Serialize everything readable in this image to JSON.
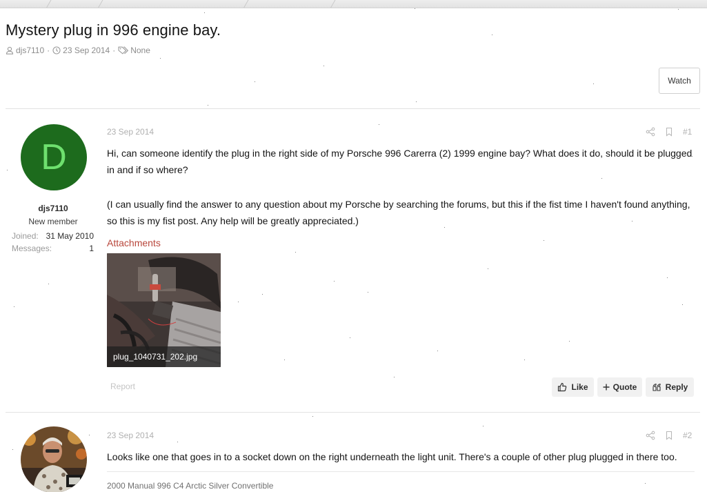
{
  "thread": {
    "title": "Mystery plug in 996 engine bay.",
    "author": "djs7110",
    "date": "23 Sep 2014",
    "tags": "None",
    "watch_label": "Watch"
  },
  "posts": [
    {
      "number": "#1",
      "date": "23 Sep 2014",
      "user": {
        "avatar_letter": "D",
        "avatar_color": "#1d6b1d",
        "name": "djs7110",
        "title": "New member",
        "joined_label": "Joined:",
        "joined_value": "31 May 2010",
        "messages_label": "Messages:",
        "messages_value": "1"
      },
      "paragraphs": [
        "Hi, can someone identify the plug in the right side of my Porsche 996 Carerra (2) 1999 engine bay? What does it do, should it be plugged in and if so where?",
        "(I can usually find the answer to any question about my Porsche by searching the forums, but this if the fist time I haven't found anything, so this is my fist post. Any help will be greatly appreciated.)"
      ],
      "attachments_label": "Attachments",
      "attachment_filename": "plug_1040731_202.jpg",
      "report_label": "Report",
      "like_label": "Like",
      "quote_label": "Quote",
      "reply_label": "Reply"
    },
    {
      "number": "#2",
      "date": "23 Sep 2014",
      "text": "Looks like one that goes in to a socket down on the right underneath the light unit. There's a couple of other plug plugged in there too.",
      "signature": "2000 Manual 996 C4 Arctic Silver Convertible"
    }
  ],
  "colors": {
    "attachments_label": "#b8463b",
    "muted": "#b0b0b0",
    "button_bg": "#f1f1f1"
  },
  "icons": {
    "author": "user-icon",
    "date": "clock-icon",
    "tags": "tag-icon",
    "share": "share-icon",
    "bookmark": "bookmark-icon",
    "like": "thumbs-up-icon",
    "quote": "plus-icon",
    "reply": "quote-marks-icon"
  }
}
